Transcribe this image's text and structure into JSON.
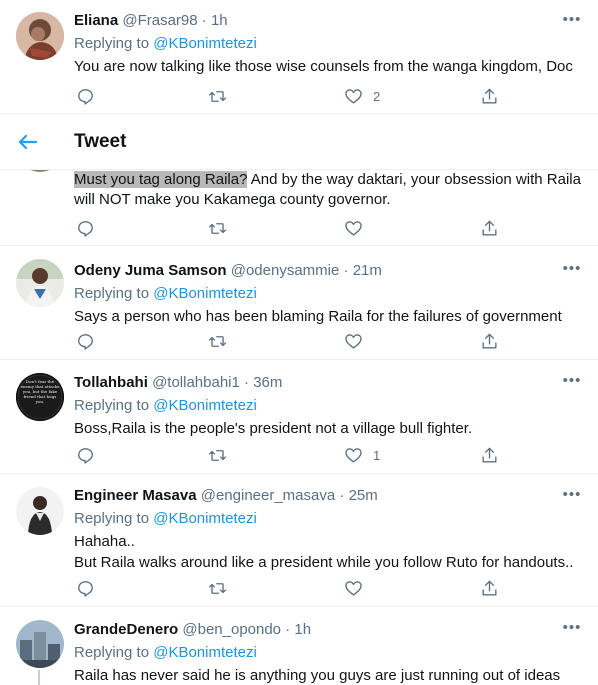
{
  "header": {
    "title": "Tweet"
  },
  "tweets": [
    {
      "name": "Eliana",
      "handle": "@Frasar98",
      "time": "1h",
      "replying_prefix": "Replying to ",
      "mention": "@KBonimtetezi",
      "text": "You are now talking like those wise counsels from the wanga kingdom, Doc",
      "likes": "2"
    },
    {
      "text_highlight": "Must you tag along Raila?",
      "text_line1_rest": " And by the way daktari, your obsession with Raila",
      "text_line2": "will NOT make you Kakamega county governor."
    },
    {
      "name": "Odeny Juma Samson",
      "handle": "@odenysammie",
      "time": "21m",
      "replying_prefix": "Replying to ",
      "mention": "@KBonimtetezi",
      "text": "Says a person who has been blaming Raila for the failures of government"
    },
    {
      "name": "Tollahbahi",
      "handle": "@tollahbahi1",
      "time": "36m",
      "replying_prefix": "Replying to ",
      "mention": "@KBonimtetezi",
      "text": "Boss,Raila is the people's president not a village bull fighter.",
      "likes": "1",
      "avatar_text": "Don't fear the enemy that attacks you, but the fake friend that hugs you."
    },
    {
      "name": "Engineer Masava",
      "handle": "@engineer_masava",
      "time": "25m",
      "replying_prefix": "Replying to ",
      "mention": "@KBonimtetezi",
      "text_line1": "Hahaha..",
      "text_line2": "But Raila walks around like a president while you follow Ruto for handouts.."
    },
    {
      "name": "GrandeDenero",
      "handle": "@ben_opondo",
      "time": "1h",
      "replying_prefix": "Replying to ",
      "mention": "@KBonimtetezi",
      "text": "Raila has never said he is anything you guys are just running out of ideas"
    }
  ],
  "sep": "·",
  "more_glyph": "•••"
}
